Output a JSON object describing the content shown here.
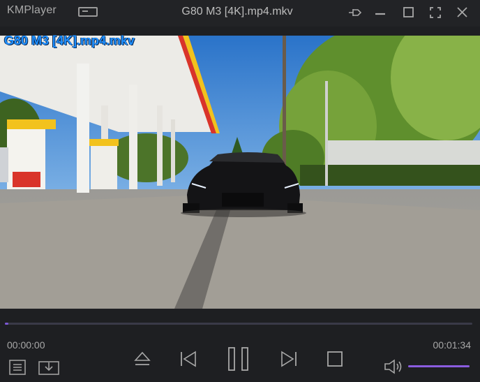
{
  "app": {
    "logo": "KMPlayer"
  },
  "window": {
    "title": "G80 M3 [4K].mp4.mkv"
  },
  "video": {
    "osd_filename": "G80 M3 [4K].mp4.mkv"
  },
  "playback": {
    "current_time": "00:00:00",
    "total_time": "00:01:34",
    "progress": 0.008
  },
  "volume": {
    "level": 1.0
  },
  "colors": {
    "accent": "#7d58d6",
    "osd_text": "#1e8fff",
    "background": "#1e1f22"
  },
  "icons": {
    "mini": "mini-mode-icon",
    "pin": "pin-icon",
    "minimize": "minimize-icon",
    "maximize": "maximize-icon",
    "fullscreen": "fullscreen-icon",
    "close": "close-icon",
    "playlist": "playlist-icon",
    "capture": "download-icon",
    "eject": "eject-icon",
    "prev": "skip-previous-icon",
    "pause": "pause-icon",
    "next": "skip-next-icon",
    "stop": "stop-icon",
    "speaker": "speaker-icon"
  }
}
